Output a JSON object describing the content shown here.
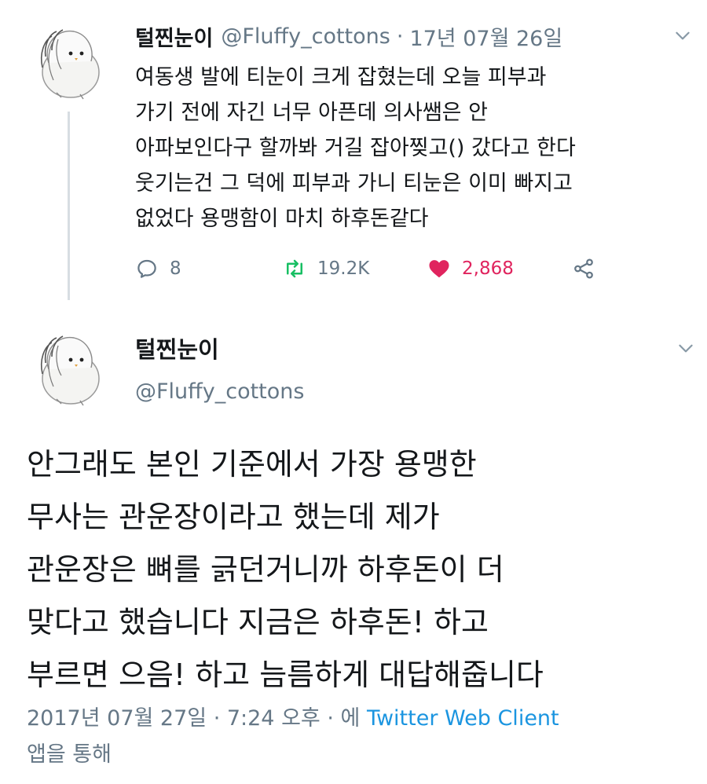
{
  "tweet1": {
    "display_name": "털찐눈이",
    "handle": "@Fluffy_cottons",
    "separator": "·",
    "date": "17년 07월 26일",
    "lines": [
      "여동생 발에 티눈이 크게 잡혔는데 오늘 피부과",
      "가기 전에 자긴 너무 아픈데 의사쌤은 안",
      "아파보인다구 할까봐 거길 잡아찢고() 갔다고 한다",
      "웃기는건 그 덕에 피부과 가니 티눈은 이미 빠지고",
      "없었다 용맹함이 마치 하후돈같다"
    ],
    "actions": {
      "reply_count": "8",
      "retweet_count": "19.2K",
      "like_count": "2,868"
    }
  },
  "tweet2": {
    "display_name": "털찐눈이",
    "handle": "@Fluffy_cottons",
    "lines": [
      "안그래도 본인 기준에서 가장 용맹한",
      "무사는 관운장이라고 했는데 제가",
      "관운장은 뼈를 긁던거니까 하후돈이 더",
      "맞다고 했습니다 지금은 하후돈! 하고",
      "부르면 으음! 하고 늠름하게 대답해줍니다"
    ],
    "meta": {
      "timestamp": "2017년 07월 27일 · 7:24 오후 · 에",
      "via": "Twitter Web Client",
      "suffix": "앱을 통해"
    }
  },
  "icons": {
    "avatar": "fluffy-bird-avatar",
    "menu": "chevron-down-icon",
    "reply": "reply-icon",
    "retweet": "retweet-icon",
    "like": "heart-icon",
    "share": "share-icon"
  },
  "colors": {
    "text": "#14171a",
    "muted": "#657786",
    "like": "#e0245e",
    "retweet": "#17bf63",
    "link": "#1b95e0"
  }
}
